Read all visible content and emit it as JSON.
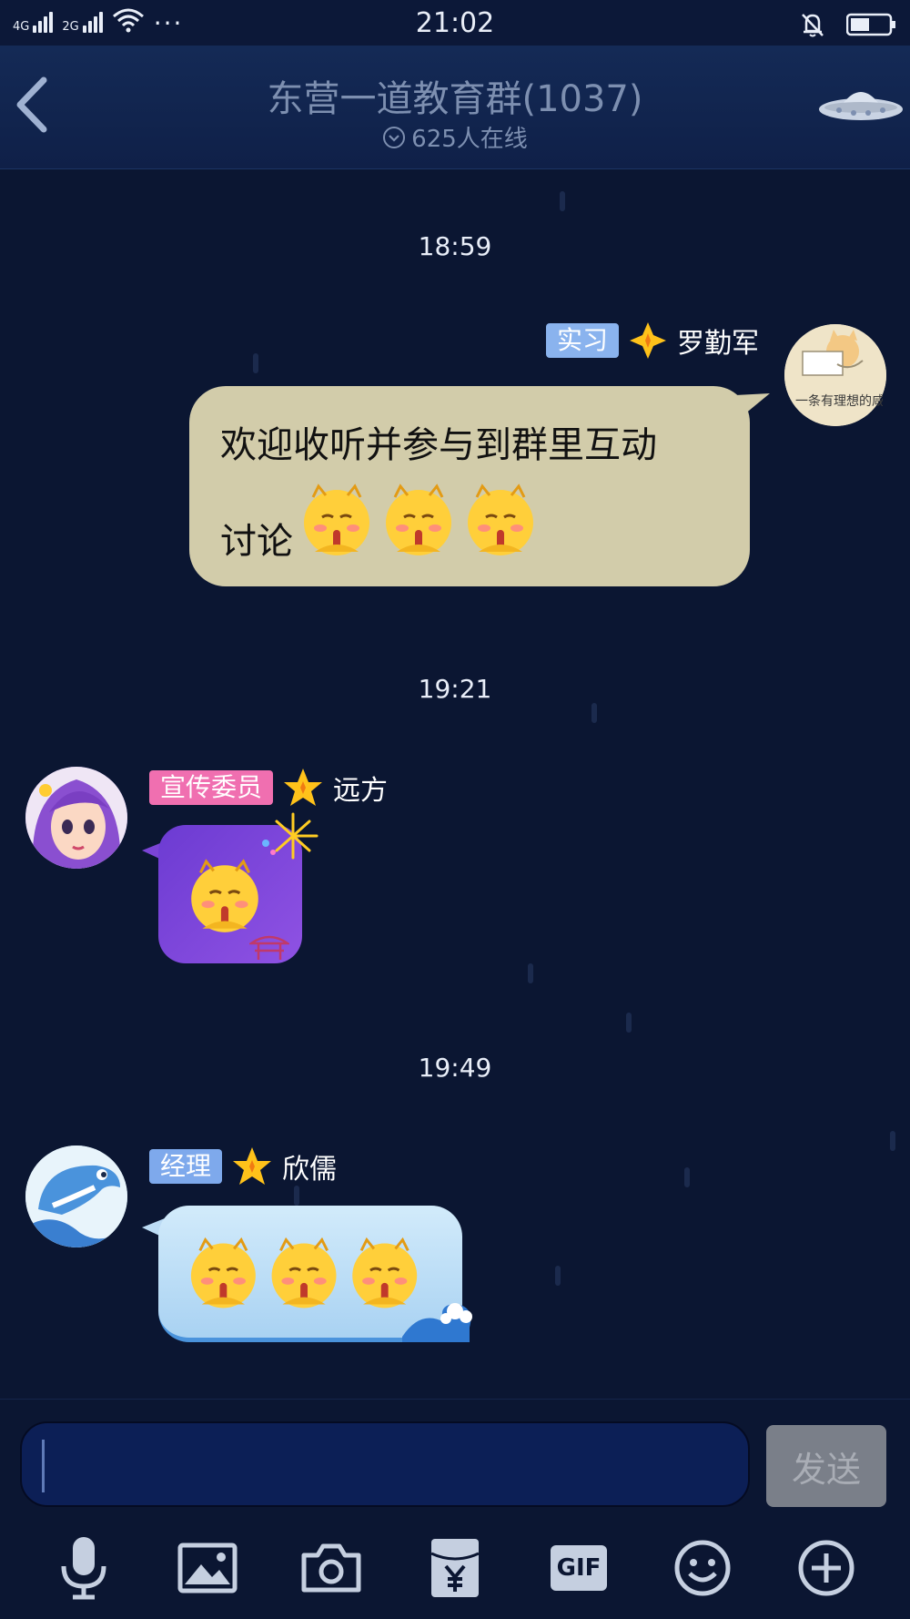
{
  "status_bar": {
    "network1": "4G",
    "network2": "2G",
    "time": "21:02",
    "more": "···"
  },
  "header": {
    "title": "东营一道教育群(1037)",
    "online": "625人在线"
  },
  "messages": [
    {
      "timestamp": "18:59",
      "badge": "实习",
      "name": "罗勤军",
      "text_line1": "欢迎收听并参与到群里互动",
      "text_line2": "讨论",
      "avatar_text": "一条有理想的咸"
    },
    {
      "timestamp": "19:21",
      "badge": "宣传委员",
      "name": "远方"
    },
    {
      "timestamp": "19:49",
      "badge": "经理",
      "name": "欣儒"
    }
  ],
  "input": {
    "send_label": "发送",
    "gif_label": "GIF"
  },
  "colors": {
    "background": "#0b1632",
    "badge_intern": "#8ab3ee",
    "badge_propaganda": "#f06fb0",
    "badge_manager": "#7ea9ec",
    "bubble_beige": "#d2ccaa",
    "bubble_purple": "#7b44d6",
    "bubble_blue": "#bcdcf5"
  }
}
